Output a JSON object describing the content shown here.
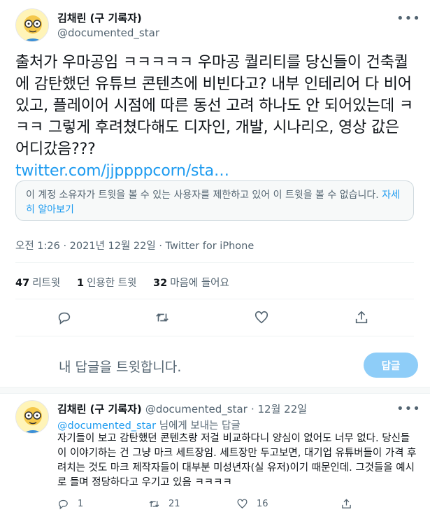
{
  "tweet": {
    "author_name": "김채린 (구 기록자)",
    "author_handle": "@documented_star",
    "more_icon": "ellipsis-icon",
    "text": "출처가 우마공임 ㅋㅋㅋㅋㅋ 우마공 퀄리티를 당신들이 건축퀄에 감탄했던 유튜브 콘텐츠에 비빈다고? 내부 인테리어 다 비어있고, 플레이어 시점에 따른 동선 고려 하나도 안 되어있는데 ㅋㅋㅋ 그렇게 후려쳤다해도 디자인, 개발, 시나리오, 영상 값은 어디갔음???",
    "link": "twitter.com/jjppppcorn/sta…",
    "notice_text": "이 계정 소유자가 트윗을 볼 수 있는 사용자를 제한하고 있어 이 트윗을 볼 수 없습니다.",
    "notice_link": "자세히 알아보기",
    "timestamp": "오전 1:26 · 2021년 12월 22일 · Twitter for iPhone",
    "stats": {
      "retweets_count": "47",
      "retweets_label": "리트윗",
      "quotes_count": "1",
      "quotes_label": "인용한 트윗",
      "likes_count": "32",
      "likes_label": "마음에 들어요"
    }
  },
  "compose": {
    "placeholder": "내 답글을 트윗합니다.",
    "button_label": "답글"
  },
  "reply": {
    "author_name": "김채린 (구 기록자)",
    "author_handle": "@documented_star",
    "date": "· 12월 22일",
    "replying_to_handle": "@documented_star",
    "replying_to_suffix": "님에게 보내는 답글",
    "text": "자기들이 보고 감탄했던 콘텐츠랑 저걸 비교하다니 양심이 없어도 너무 없다. 당신들이 이야기하는 건 그냥 마크 세트장임. 세트장만 두고보면, 대기업 유튜버들이 가격 후려치는 것도 마크 제작자들이 대부분 미성년자(실 유저)이기 때문인데. 그것들을 예시로 들며 정당하다고 우기고 있음 ㅋㅋㅋㅋ",
    "reply_count": "1",
    "retweet_count": "21",
    "like_count": "16"
  },
  "colors": {
    "accent": "#1d9bf0",
    "muted": "#536471",
    "button_disabled": "#8ecdf8"
  }
}
